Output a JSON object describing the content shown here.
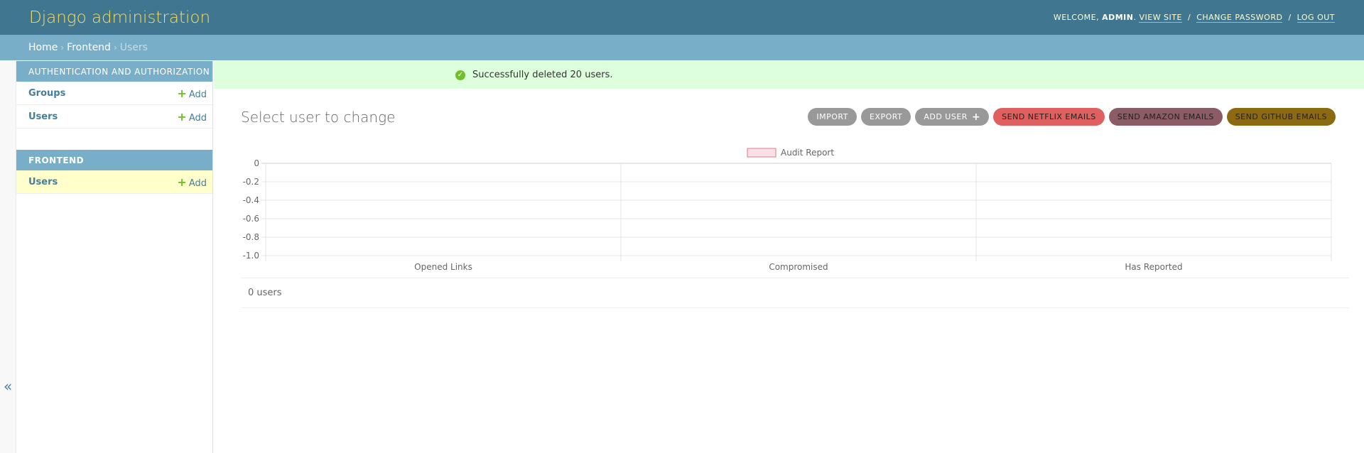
{
  "header": {
    "brand": "Django administration",
    "welcome": "Welcome,",
    "username": "admin",
    "view_site": "View site",
    "change_password": "Change password",
    "log_out": "Log out",
    "separator": "/"
  },
  "breadcrumbs": {
    "home": "Home",
    "app": "Frontend",
    "current": "Users",
    "sep": "›"
  },
  "sidebar": {
    "modules": [
      {
        "caption": "Authentication and Authorization",
        "rows": [
          {
            "label": "Groups",
            "add": "Add"
          },
          {
            "label": "Users",
            "add": "Add"
          }
        ]
      },
      {
        "caption": "Frontend",
        "rows": [
          {
            "label": "Users",
            "add": "Add"
          }
        ]
      }
    ],
    "toggle": "«"
  },
  "messages": {
    "success": "Successfully deleted 20 users.",
    "icon": "check-icon"
  },
  "content": {
    "title": "Select user to change",
    "result_count": "0 users"
  },
  "object_tools": {
    "import": "Import",
    "export": "Export",
    "add_user": "Add user",
    "netflix": "Send Netflix emails",
    "amazon": "Send Amazon emails",
    "github": "Send Github emails"
  },
  "colors": {
    "header_bg": "#417690",
    "brand": "#f5dd5d",
    "breadcrumbs_bg": "#79aec8",
    "success_bg": "#dfd",
    "netflix": "#e05f5f",
    "amazon": "#8b5c66",
    "github": "#8c6a12",
    "series_fill": "#fde0e6",
    "series_stroke": "#e07a8c"
  },
  "chart_data": {
    "type": "bar",
    "categories": [
      "Opened Links",
      "Compromised",
      "Has Reported"
    ],
    "series": [
      {
        "name": "Audit Report",
        "values": [
          0,
          0,
          0
        ]
      }
    ],
    "yticks": [
      "0",
      "-0.2",
      "-0.4",
      "-0.6",
      "-0.8",
      "-1.0"
    ],
    "ylim": [
      -1.0,
      0
    ],
    "legend": "top",
    "grid": true
  }
}
